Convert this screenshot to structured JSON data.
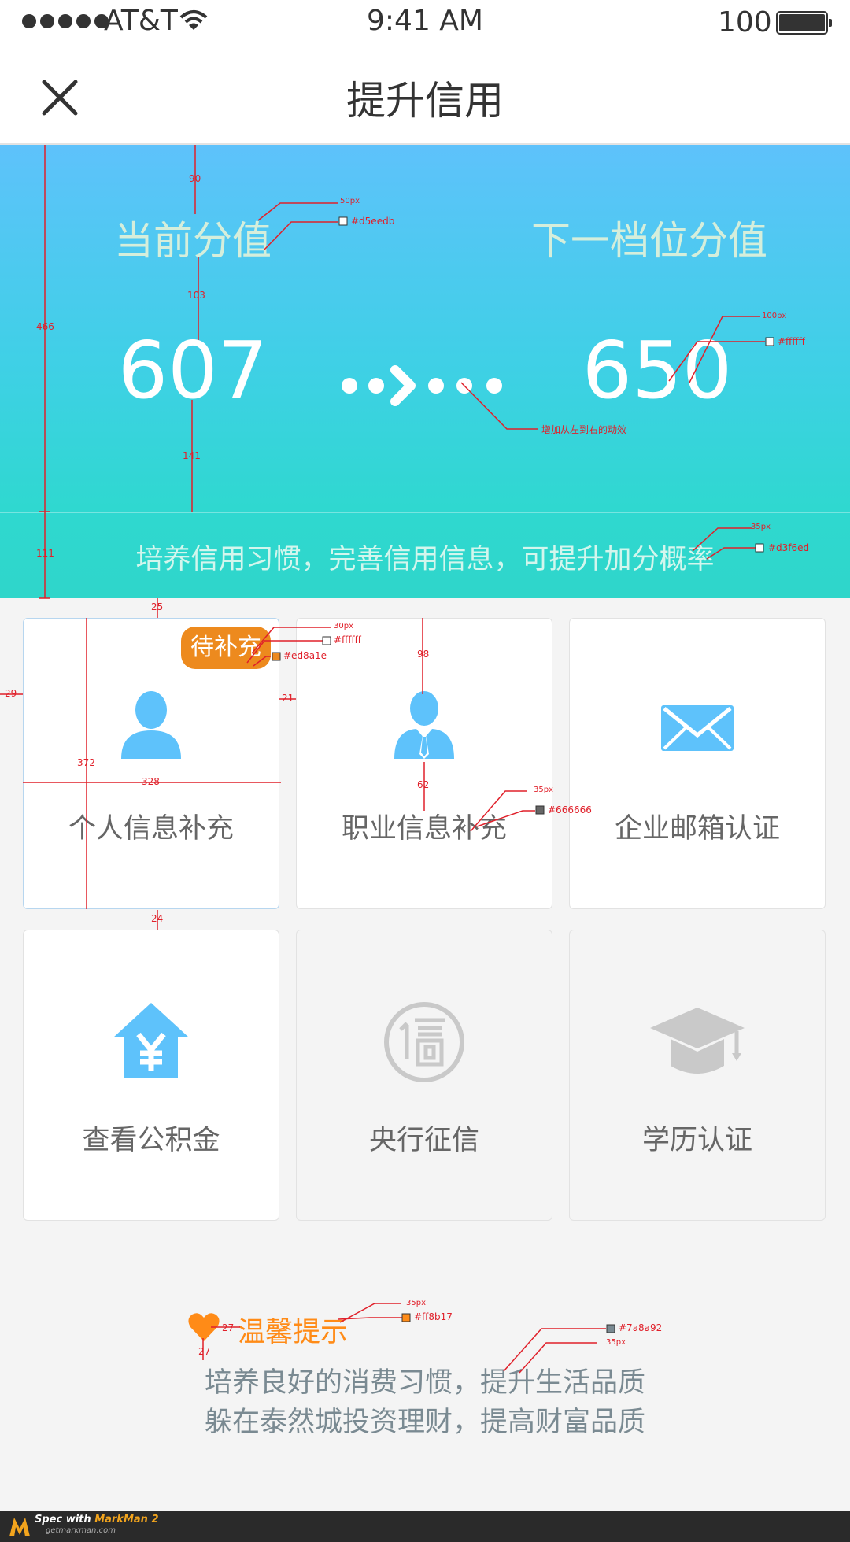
{
  "status_bar": {
    "carrier": "AT&T",
    "time": "9:41 AM",
    "battery": "100"
  },
  "nav": {
    "title": "提升信用",
    "close_icon": "close-icon"
  },
  "banner": {
    "current_label": "当前分值",
    "next_label": "下一档位分值",
    "current_score": "607",
    "next_score": "650",
    "tip": "培养信用习惯，完善信用信息，可提升加分概率",
    "colors": {
      "label": "#d5eedb",
      "score": "#ffffff",
      "tip": "#d3f6ed"
    }
  },
  "cards": [
    {
      "label": "个人信息补充",
      "icon": "person-icon",
      "badge": "待补充"
    },
    {
      "label": "职业信息补充",
      "icon": "businessman-icon"
    },
    {
      "label": "企业邮箱认证",
      "icon": "envelope-icon"
    },
    {
      "label": "查看公积金",
      "icon": "house-yuan-icon"
    },
    {
      "label": "央行征信",
      "icon": "credit-seal-icon"
    },
    {
      "label": "学历认证",
      "icon": "graduation-cap-icon"
    }
  ],
  "tips": {
    "title": "温馨提示",
    "lines": [
      "培养良好的消费习惯，提升生活品质",
      "躲在泰然城投资理财，提高财富品质"
    ],
    "colors": {
      "title": "#ff8b17",
      "text": "#7a8a92"
    }
  },
  "annotations": {
    "a_90": "90",
    "a_103": "103",
    "a_141": "141",
    "a_466": "466",
    "a_111": "111",
    "a_50px": "50px",
    "a_d5eedb": "#d5eedb",
    "a_100px": "100px",
    "a_ffffff": "#ffffff",
    "a_anim": "增加从左到右的动效",
    "a_35px_banner": "35px",
    "a_d3f6ed": "#d3f6ed",
    "a_25": "25",
    "a_29": "29",
    "a_21": "21",
    "a_372": "372",
    "a_328": "328",
    "a_24": "24",
    "a_30px": "30px",
    "a_ffffff_badge": "#ffffff",
    "a_ed8a1e": "#ed8a1e",
    "a_98": "98",
    "a_62": "62",
    "a_35px_card": "35px",
    "a_666666": "#666666",
    "a_35px_tips": "35px",
    "a_ff8b17": "#ff8b17",
    "a_27a": "27",
    "a_27b": "27",
    "a_7a8a92": "#7a8a92",
    "a_35px_text": "35px"
  },
  "footer": {
    "brand_prefix": "Spec with ",
    "brand_name": "MarkMan 2",
    "site": "getmarkman.com"
  }
}
